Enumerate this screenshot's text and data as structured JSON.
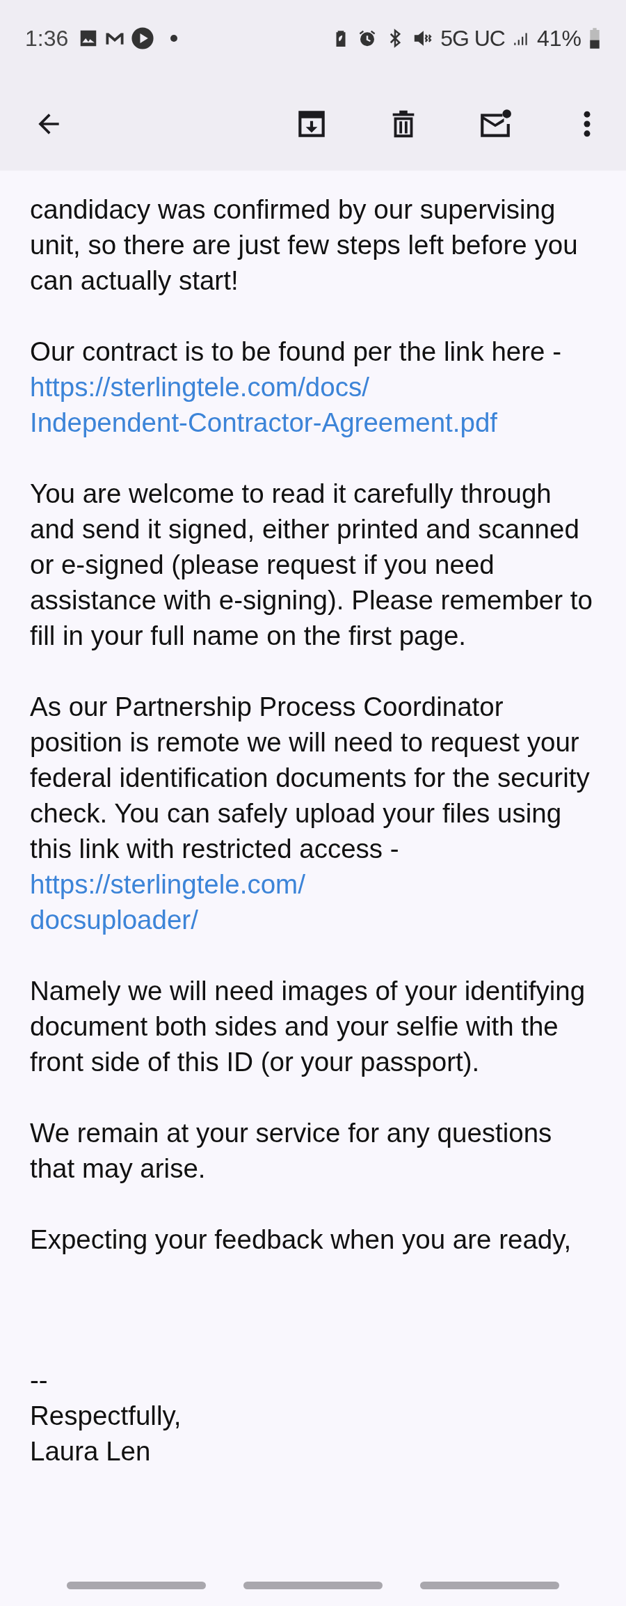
{
  "status_bar": {
    "time": "1:36",
    "network": "5G UC",
    "battery": "41%"
  },
  "body": {
    "paragraphs": [
      {
        "text": "candidacy was confirmed by our supervising unit, so there are just few steps left before you can actually start!"
      },
      {
        "text": "Our contract is to be found per the link here - ",
        "link": [
          "https://sterlingtele.com/docs/",
          "Independent-Contractor-Agreement.pdf"
        ]
      },
      {
        "text": "You are welcome to read it carefully through and send it signed, either printed and scanned or e-signed (please request if you need assistance with e-signing). Please remember to fill in your full name on the first page."
      },
      {
        "text": "As our Partnership Process Coordinator position is remote we will need to request your federal identification documents for the security check. You can safely upload your files using this link with restricted access - ",
        "link": [
          "https://sterlingtele.com/",
          "docsuploader/"
        ]
      },
      {
        "text": "Namely we will need images of your identifying document both sides and your selfie with the front side of this ID (or your passport)."
      },
      {
        "text": "We remain at your service for any questions that may arise."
      },
      {
        "text": "Expecting your feedback when you are ready,"
      }
    ],
    "signature": [
      "--",
      "Respectfully,",
      "Laura Len"
    ]
  }
}
